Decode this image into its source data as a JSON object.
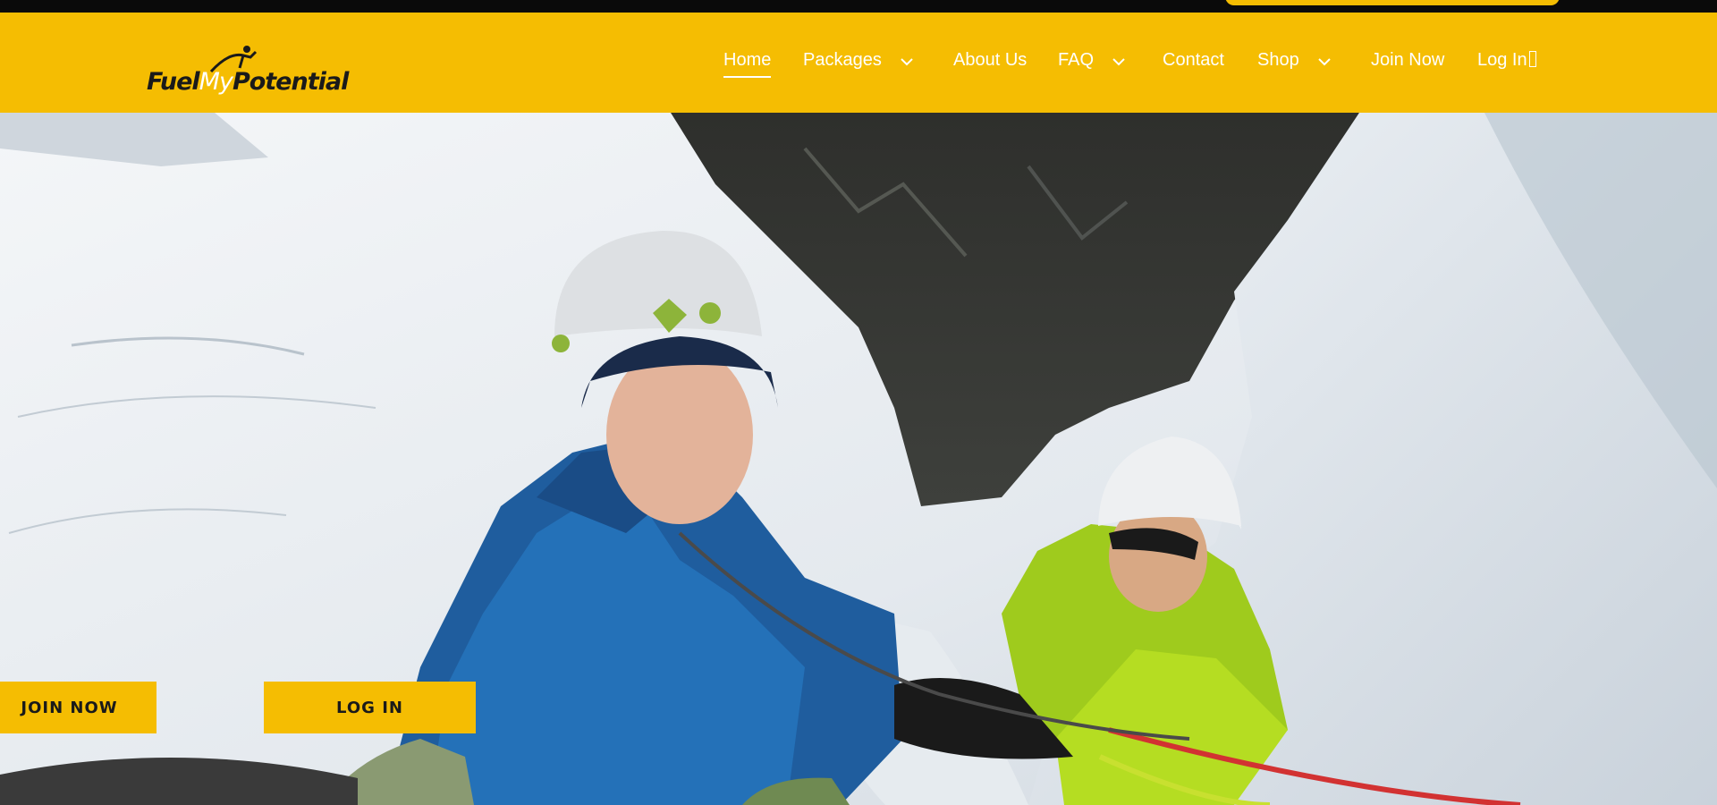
{
  "brand": {
    "logo_text_1": "Fuel",
    "logo_text_2": "My",
    "logo_text_3": "Potential",
    "accent": "#f5bd02"
  },
  "nav": {
    "items": [
      {
        "label": "Home",
        "active": true
      },
      {
        "label": "Packages",
        "dropdown": true
      },
      {
        "label": "About Us"
      },
      {
        "label": "FAQ",
        "dropdown": true
      },
      {
        "label": "Contact"
      },
      {
        "label": "Shop",
        "dropdown": true
      },
      {
        "label": "Join Now"
      },
      {
        "label": "Log In "
      }
    ]
  },
  "hero": {
    "image": "two ice climbers in helmets on snowy rock face",
    "buttons": {
      "join": "JOIN NOW",
      "login": "LOG IN"
    }
  }
}
